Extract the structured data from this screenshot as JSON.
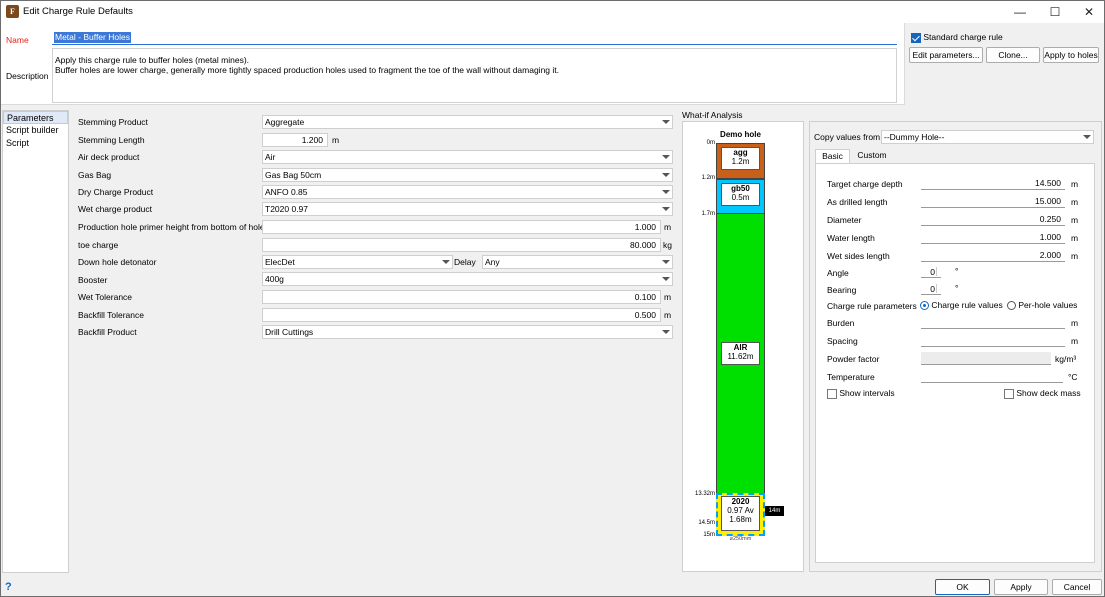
{
  "window": {
    "title": "Edit Charge Rule Defaults",
    "app_icon_glyph": "F",
    "controls": {
      "minimize": "—",
      "maximize": "☐",
      "close": "✕"
    }
  },
  "header": {
    "name_label": "Name",
    "name_value": "Metal - Buffer Holes",
    "description_label": "Description",
    "description_line1": "Apply this charge rule to buffer holes (metal mines).",
    "description_line2": "Buffer holes are lower charge, generally more tightly spaced production holes used to fragment the toe of the wall without damaging it.",
    "standard_label": "Standard charge rule",
    "edit_params": "Edit parameters...",
    "clone": "Clone...",
    "apply_holes": "Apply to holes"
  },
  "nav": {
    "items": [
      "Parameters",
      "Script builder",
      "Script"
    ]
  },
  "params": {
    "stemming_product": {
      "label": "Stemming Product",
      "value": "Aggregate"
    },
    "stemming_length": {
      "label": "Stemming Length",
      "value": "1.200",
      "unit": "m"
    },
    "air_deck": {
      "label": "Air deck product",
      "value": "Air"
    },
    "gas_bag": {
      "label": "Gas Bag",
      "value": "Gas Bag 50cm"
    },
    "dry_charge": {
      "label": "Dry Charge Product",
      "value": "ANFO 0.85"
    },
    "wet_charge": {
      "label": "Wet charge product",
      "value": "T2020 0.97"
    },
    "primer_height": {
      "label": "Production hole primer height from bottom of hole",
      "value": "1.000",
      "unit": "m"
    },
    "toe_charge": {
      "label": "toe charge",
      "value": "80.000",
      "unit": "kg"
    },
    "detonator": {
      "label": "Down hole detonator",
      "value": "ElecDet",
      "delay_label": "Delay",
      "delay_value": "Any"
    },
    "booster": {
      "label": "Booster",
      "value": "400g"
    },
    "wet_tol": {
      "label": "Wet Tolerance",
      "value": "0.100",
      "unit": "m"
    },
    "backfill_tol": {
      "label": "Backfill Tolerance",
      "value": "0.500",
      "unit": "m"
    },
    "backfill_product": {
      "label": "Backfill Product",
      "value": "Drill Cuttings"
    }
  },
  "whatif": {
    "heading": "What-if Analysis",
    "hole_title": "Demo hole",
    "depth_labels": [
      "0m",
      "1.2m",
      "1.7m",
      "13.32m",
      "14.5m",
      "15m"
    ],
    "segments": {
      "agg": {
        "name": "agg",
        "len": "1.2m",
        "color": "#c8601a"
      },
      "gb50": {
        "name": "gb50",
        "len": "0.5m",
        "color": "#00c8ff"
      },
      "air": {
        "name": "AIR",
        "len": "11.62m",
        "color": "#00e000"
      },
      "t2020": {
        "name": "2020",
        "line2": "0.97 Av",
        "len": "1.68m",
        "color": "#ffee00"
      }
    },
    "marker": "14m",
    "diameter_label": "⌀250mm"
  },
  "copy": {
    "label": "Copy values from",
    "value": "--Dummy Hole--",
    "tabs": [
      "Basic",
      "Custom"
    ]
  },
  "basic": {
    "target_depth": {
      "label": "Target charge depth",
      "value": "14.500",
      "unit": "m"
    },
    "drilled_len": {
      "label": "As drilled length",
      "value": "15.000",
      "unit": "m"
    },
    "diameter": {
      "label": "Diameter",
      "value": "0.250",
      "unit": "m"
    },
    "water_len": {
      "label": "Water length",
      "value": "1.000",
      "unit": "m"
    },
    "wet_sides": {
      "label": "Wet sides length",
      "value": "2.000",
      "unit": "m"
    },
    "angle": {
      "label": "Angle",
      "value": "0",
      "unit": "°"
    },
    "bearing": {
      "label": "Bearing",
      "value": "0",
      "unit": "°"
    },
    "crp_label": "Charge rule parameters",
    "crp_opt1": "Charge rule values",
    "crp_opt2": "Per-hole values",
    "burden": {
      "label": "Burden",
      "value": "",
      "unit": "m"
    },
    "spacing": {
      "label": "Spacing",
      "value": "",
      "unit": "m"
    },
    "powder": {
      "label": "Powder factor",
      "value": "",
      "unit": "kg/m³"
    },
    "temp": {
      "label": "Temperature",
      "value": "",
      "unit": "°C"
    },
    "show_intervals": "Show intervals",
    "show_deck_mass": "Show deck mass"
  },
  "footer": {
    "help": "?",
    "ok": "OK",
    "apply": "Apply",
    "cancel": "Cancel"
  }
}
